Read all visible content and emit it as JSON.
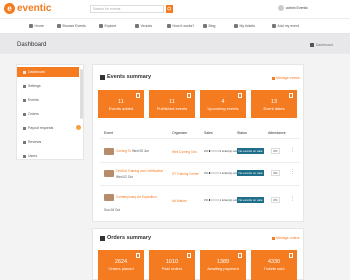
{
  "header": {
    "logo_text": "eventic",
    "search_placeholder": "Search for events",
    "user_name": "admin Eventic"
  },
  "nav": [
    "Home",
    "Browse Events",
    "Explore",
    "Venues",
    "How it works?",
    "Blog",
    "My tickets",
    "Add my event"
  ],
  "page": {
    "title": "Dashboard",
    "breadcrumb": "Dashboard"
  },
  "sidebar": {
    "items": [
      {
        "label": "Dashboard",
        "active": true
      },
      {
        "label": "Settings",
        "active": false
      },
      {
        "label": "Events",
        "active": false
      },
      {
        "label": "Orders",
        "active": false
      },
      {
        "label": "Payout requests",
        "active": false
      },
      {
        "label": "Reviews",
        "active": false
      },
      {
        "label": "Users",
        "active": false
      }
    ]
  },
  "events_summary": {
    "title": "Events summary",
    "manage_label": "Manage events",
    "stats": [
      {
        "value": "11",
        "label": "Events added"
      },
      {
        "value": "11",
        "label": "Published events"
      },
      {
        "value": "4",
        "label": "Upcoming events"
      },
      {
        "value": "13",
        "label": "Event dates"
      }
    ],
    "columns": [
      "Event",
      "Organizer",
      "Sales",
      "Status",
      "Attendance"
    ],
    "rows": [
      {
        "name": "Coming To",
        "date": "Wed 05 Jun",
        "organizer": "Well Coming Toto",
        "sales_pct": "2%",
        "sales_text": "9 ticket(s) sold",
        "status": "No events on sale",
        "attendance": "0%"
      },
      {
        "name": "OneDot Training and Certification",
        "date": "Wed 02 Oct",
        "organizer": "ST Training Center",
        "sales_pct": "2%",
        "sales_text": "1 ticket(s) sold",
        "status": "No events on sale",
        "attendance": "0%"
      },
      {
        "name": "Contemporary Art Exposition",
        "date": "Sun 06 Oct",
        "organizer": "Art Market",
        "sales_pct": "2%",
        "sales_text": "1 ticket(s) sold",
        "status": "No events on sale",
        "attendance": "0%"
      }
    ]
  },
  "orders_summary": {
    "title": "Orders summary",
    "manage_label": "Manage orders",
    "stats": [
      {
        "value": "2624",
        "label": "Orders placed"
      },
      {
        "value": "1010",
        "label": "Paid orders"
      },
      {
        "value": "1389",
        "label": "Awaiting payment"
      },
      {
        "value": "4330",
        "label": "Tickets sold"
      }
    ]
  },
  "colors": {
    "accent": "#f47b20",
    "status": "#1f6f8b"
  }
}
